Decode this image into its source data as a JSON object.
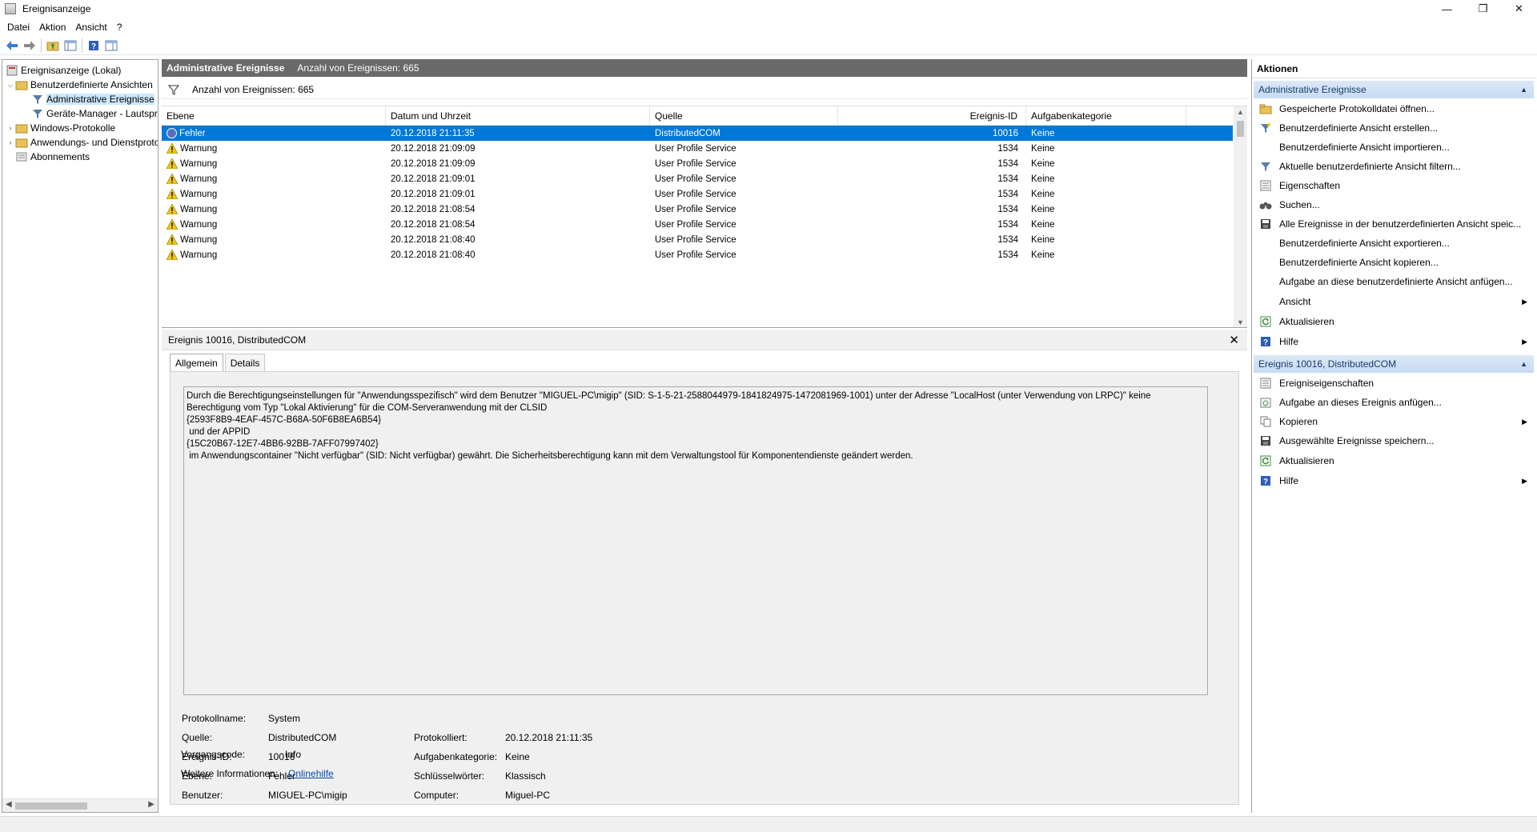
{
  "window": {
    "title": "Ereignisanzeige",
    "btn_min": "—",
    "btn_max": "❐",
    "btn_close": "✕"
  },
  "menu": [
    "Datei",
    "Aktion",
    "Ansicht",
    "?"
  ],
  "tree": [
    {
      "label": "Ereignisanzeige (Lokal)"
    },
    {
      "label": "Benutzerdefinierte Ansichten"
    },
    {
      "label": "Administrative Ereignisse"
    },
    {
      "label": "Geräte-Manager - Lautsprecher"
    },
    {
      "label": "Windows-Protokolle"
    },
    {
      "label": "Anwendungs- und Dienstprotokolle"
    },
    {
      "label": "Abonnements"
    }
  ],
  "center": {
    "title": "Administrative Ereignisse",
    "count": "Anzahl von Ereignissen: 665",
    "filter_text": "Anzahl von Ereignissen: 665"
  },
  "grid": {
    "columns": [
      "Ebene",
      "Datum und Uhrzeit",
      "Quelle",
      "Ereignis-ID",
      "Aufgabenkategorie"
    ],
    "rows": [
      {
        "level": "Fehler",
        "date": "20.12.2018 21:11:35",
        "source": "DistributedCOM",
        "id": "10016",
        "cat": "Keine"
      },
      {
        "level": "Warnung",
        "date": "20.12.2018 21:09:09",
        "source": "User Profile Service",
        "id": "1534",
        "cat": "Keine"
      },
      {
        "level": "Warnung",
        "date": "20.12.2018 21:09:09",
        "source": "User Profile Service",
        "id": "1534",
        "cat": "Keine"
      },
      {
        "level": "Warnung",
        "date": "20.12.2018 21:09:01",
        "source": "User Profile Service",
        "id": "1534",
        "cat": "Keine"
      },
      {
        "level": "Warnung",
        "date": "20.12.2018 21:09:01",
        "source": "User Profile Service",
        "id": "1534",
        "cat": "Keine"
      },
      {
        "level": "Warnung",
        "date": "20.12.2018 21:08:54",
        "source": "User Profile Service",
        "id": "1534",
        "cat": "Keine"
      },
      {
        "level": "Warnung",
        "date": "20.12.2018 21:08:54",
        "source": "User Profile Service",
        "id": "1534",
        "cat": "Keine"
      },
      {
        "level": "Warnung",
        "date": "20.12.2018 21:08:40",
        "source": "User Profile Service",
        "id": "1534",
        "cat": "Keine"
      },
      {
        "level": "Warnung",
        "date": "20.12.2018 21:08:40",
        "source": "User Profile Service",
        "id": "1534",
        "cat": "Keine"
      }
    ]
  },
  "detail": {
    "title": "Ereignis 10016, DistributedCOM",
    "tabs": [
      "Allgemein",
      "Details"
    ],
    "message": "Durch die Berechtigungseinstellungen für \"Anwendungsspezifisch\" wird dem Benutzer \"MIGUEL-PC\\migip\" (SID: S-1-5-21-2588044979-1841824975-1472081969-1001) unter der Adresse \"LocalHost (unter Verwendung von LRPC)\" keine\nBerechtigung vom Typ \"Lokal Aktivierung\" für die COM-Serveranwendung mit der CLSID\n{2593F8B9-4EAF-457C-B68A-50F6B8EA6B54}\n und der APPID\n{15C20B67-12E7-4BB6-92BB-7AFF07997402}\n im Anwendungscontainer \"Nicht verfügbar\" (SID: Nicht verfügbar) gewährt. Die Sicherheitsberechtigung kann mit dem Verwaltungstool für Komponentendienste geändert werden.",
    "props": {
      "protokollname_label": "Protokollname:",
      "protokollname": "System",
      "quelle_label": "Quelle:",
      "quelle": "DistributedCOM",
      "protokolliert_label": "Protokolliert:",
      "protokolliert": "20.12.2018 21:11:35",
      "ereignisid_label": "Ereignis-ID:",
      "ereignisid": "10016",
      "aufgabe_label": "Aufgabenkategorie:",
      "aufgabe": "Keine",
      "ebene_label": "Ebene:",
      "ebene": "Fehler",
      "schluessel_label": "Schlüsselwörter:",
      "schluessel": "Klassisch",
      "benutzer_label": "Benutzer:",
      "benutzer": "MIGUEL-PC\\migip",
      "computer_label": "Computer:",
      "computer": "Miguel-PC",
      "vorgang_label": "Vorgangscode:",
      "vorgang": "Info",
      "weitere_label": "Weitere Informationen:",
      "weitere_link": "Onlinehilfe"
    }
  },
  "actions": {
    "title": "Aktionen",
    "section1": "Administrative Ereignisse",
    "items1": [
      {
        "label": "Gespeicherte Protokolldatei öffnen...",
        "icon": "folder-open-icon"
      },
      {
        "label": "Benutzerdefinierte Ansicht erstellen...",
        "icon": "filter-icon"
      },
      {
        "label": "Benutzerdefinierte Ansicht importieren...",
        "icon": ""
      },
      {
        "label": "Aktuelle benutzerdefinierte Ansicht filtern...",
        "icon": "filter-icon"
      },
      {
        "label": "Eigenschaften",
        "icon": "properties-icon"
      },
      {
        "label": "Suchen...",
        "icon": "binoculars-icon"
      },
      {
        "label": "Alle Ereignisse in der benutzerdefinierten Ansicht speic...",
        "icon": "save-icon"
      },
      {
        "label": "Benutzerdefinierte Ansicht exportieren...",
        "icon": ""
      },
      {
        "label": "Benutzerdefinierte Ansicht kopieren...",
        "icon": ""
      },
      {
        "label": "Aufgabe an diese benutzerdefinierte Ansicht anfügen...",
        "icon": ""
      },
      {
        "label": "Ansicht",
        "icon": "",
        "submenu": true
      },
      {
        "label": "Aktualisieren",
        "icon": "refresh-icon"
      },
      {
        "label": "Hilfe",
        "icon": "help-icon",
        "submenu": true
      }
    ],
    "section2": "Ereignis 10016, DistributedCOM",
    "items2": [
      {
        "label": "Ereigniseigenschaften",
        "icon": "properties-icon"
      },
      {
        "label": "Aufgabe an dieses Ereignis anfügen...",
        "icon": "task-icon"
      },
      {
        "label": "Kopieren",
        "icon": "copy-icon",
        "submenu": true
      },
      {
        "label": "Ausgewählte Ereignisse speichern...",
        "icon": "save-icon"
      },
      {
        "label": "Aktualisieren",
        "icon": "refresh-icon"
      },
      {
        "label": "Hilfe",
        "icon": "help-icon",
        "submenu": true
      }
    ]
  }
}
